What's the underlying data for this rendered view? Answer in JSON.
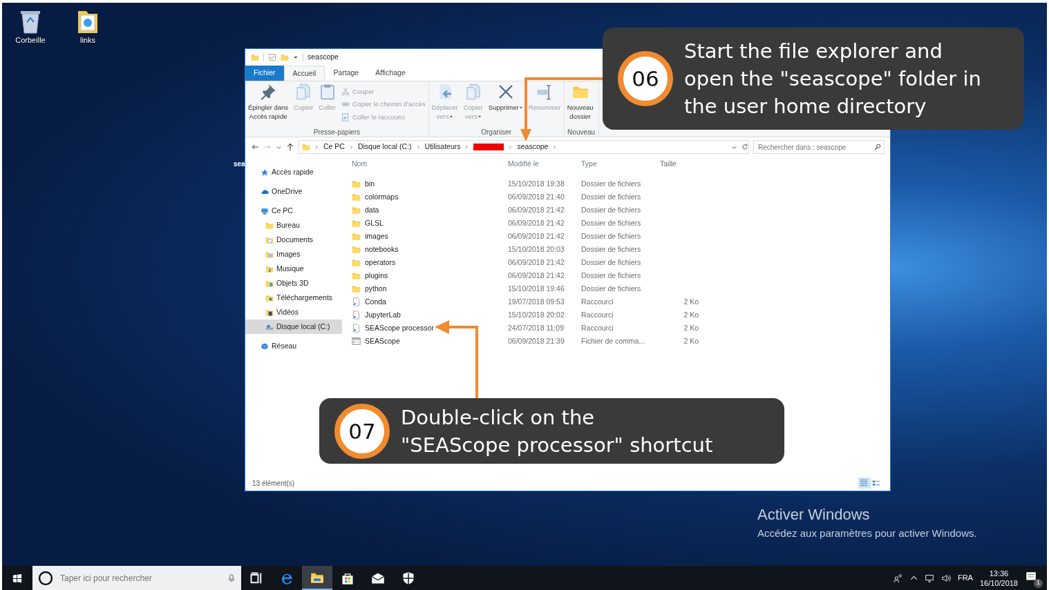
{
  "desktop_icons": [
    {
      "label": "Corbeille",
      "kind": "recycle"
    },
    {
      "label": "links",
      "kind": "folder"
    }
  ],
  "desktop_fragment": "sea",
  "window": {
    "title": "seascope",
    "ribbon_tabs": [
      {
        "label": "Fichier",
        "kind": "file",
        "selected": false
      },
      {
        "label": "Accueil",
        "kind": "tab",
        "selected": true
      },
      {
        "label": "Partage",
        "kind": "tab",
        "selected": false
      },
      {
        "label": "Affichage",
        "kind": "tab",
        "selected": false
      }
    ],
    "ribbon_groups": [
      {
        "label": "Presse-papiers",
        "large": [
          {
            "label": "Épingler dans\nAccès rapide",
            "kind": "pin",
            "disabled": false,
            "menu": false
          },
          {
            "label": "Copier",
            "kind": "copy",
            "disabled": true,
            "menu": false
          },
          {
            "label": "Coller",
            "kind": "clipboard",
            "disabled": true,
            "menu": false
          }
        ],
        "small": [
          {
            "label": "Couper",
            "kind": "scissors",
            "disabled": true
          },
          {
            "label": "Copier le chemin d'accès",
            "kind": "path",
            "disabled": true
          },
          {
            "label": "Coller le raccourci",
            "kind": "shortcut",
            "disabled": true
          }
        ]
      },
      {
        "label": "Organiser",
        "large": [
          {
            "label": "Déplacer\nvers",
            "kind": "move",
            "disabled": true,
            "menu": true
          },
          {
            "label": "Copier\nvers",
            "kind": "copy",
            "disabled": true,
            "menu": true
          },
          {
            "label": "Supprimer",
            "kind": "delete",
            "disabled": false,
            "menu": true
          },
          {
            "label": "Renommer",
            "kind": "rename",
            "disabled": true,
            "menu": false
          }
        ]
      },
      {
        "label": "Nouveau",
        "large": [
          {
            "label": "Nouveau\ndossier",
            "kind": "newfolder",
            "disabled": false,
            "menu": false
          }
        ]
      }
    ],
    "breadcrumb": [
      {
        "label": "Ce PC",
        "kind": "text"
      },
      {
        "label": "Disque local (C:)",
        "kind": "text"
      },
      {
        "label": "Utilisateurs",
        "kind": "text"
      },
      {
        "kind": "redacted"
      },
      {
        "label": "seascope",
        "kind": "text"
      }
    ],
    "search": {
      "placeholder": "Rechercher dans : seascope"
    },
    "nav": [
      {
        "label": "Accès rapide",
        "kind": "star",
        "selected": false
      },
      {
        "label": "OneDrive",
        "kind": "cloud",
        "selected": false
      },
      {
        "label": "Ce PC",
        "kind": "pc",
        "selected": false,
        "children": [
          {
            "label": "Bureau",
            "kind": "folder",
            "selected": false
          },
          {
            "label": "Documents",
            "kind": "docs",
            "selected": false
          },
          {
            "label": "Images",
            "kind": "pics",
            "selected": false
          },
          {
            "label": "Musique",
            "kind": "music",
            "selected": false
          },
          {
            "label": "Objets 3D",
            "kind": "obj3d",
            "selected": false
          },
          {
            "label": "Téléchargements",
            "kind": "download",
            "selected": false
          },
          {
            "label": "Vidéos",
            "kind": "video",
            "selected": false
          },
          {
            "label": "Disque local (C:)",
            "kind": "drive",
            "selected": true
          }
        ]
      },
      {
        "label": "Réseau",
        "kind": "network",
        "selected": false
      }
    ],
    "columns": [
      "Nom",
      "Modifié le",
      "Type",
      "Taille"
    ],
    "rows": [
      {
        "kind": "folder",
        "name": "bin",
        "modified": "15/10/2018 19:38",
        "type": "Dossier de fichiers"
      },
      {
        "kind": "folder",
        "name": "colormaps",
        "modified": "06/09/2018 21:40",
        "type": "Dossier de fichiers"
      },
      {
        "kind": "folder",
        "name": "data",
        "modified": "06/09/2018 21:42",
        "type": "Dossier de fichiers"
      },
      {
        "kind": "folder",
        "name": "GLSL",
        "modified": "06/09/2018 21:42",
        "type": "Dossier de fichiers"
      },
      {
        "kind": "folder",
        "name": "images",
        "modified": "06/09/2018 21:42",
        "type": "Dossier de fichiers"
      },
      {
        "kind": "folder",
        "name": "notebooks",
        "modified": "15/10/2018 20:03",
        "type": "Dossier de fichiers"
      },
      {
        "kind": "folder",
        "name": "operators",
        "modified": "06/09/2018 21:42",
        "type": "Dossier de fichiers"
      },
      {
        "kind": "folder",
        "name": "plugins",
        "modified": "06/09/2018 21:42",
        "type": "Dossier de fichiers"
      },
      {
        "kind": "folder",
        "name": "python",
        "modified": "15/10/2018 19:46",
        "type": "Dossier de fichiers"
      },
      {
        "kind": "shortcut",
        "name": "Conda",
        "modified": "19/07/2018 09:53",
        "type": "Raccourci",
        "size": "2 Ko"
      },
      {
        "kind": "shortcut",
        "name": "JupyterLab",
        "modified": "15/10/2018 20:02",
        "type": "Raccourci",
        "size": "2 Ko"
      },
      {
        "kind": "shortcut",
        "name": "SEAScope processor",
        "modified": "24/07/2018 11:09",
        "type": "Raccourci",
        "size": "2 Ko"
      },
      {
        "kind": "script",
        "name": "SEAScope",
        "modified": "06/09/2018 21:39",
        "type": "Fichier de comma...",
        "size": "2 Ko"
      }
    ],
    "status": "13 élément(s)",
    "views": [
      {
        "kind": "details",
        "selected": true
      },
      {
        "kind": "tiles",
        "selected": false
      }
    ]
  },
  "callouts": [
    {
      "number": "06",
      "text": "Start the file explorer and\nopen the \"seascope\" folder in\nthe user home directory"
    },
    {
      "number": "07",
      "text": "Double-click on the\n\"SEAScope processor\" shortcut"
    }
  ],
  "activation": {
    "title": "Activer Windows",
    "text": "Accédez aux paramètres pour activer Windows."
  },
  "taskbar": {
    "search_placeholder": "Taper ici pour rechercher",
    "apps": [
      {
        "kind": "taskview",
        "active": false
      },
      {
        "kind": "browser",
        "active": false
      },
      {
        "kind": "explorer",
        "active": true
      },
      {
        "kind": "store",
        "active": false
      },
      {
        "kind": "mail",
        "active": false
      },
      {
        "kind": "shield",
        "active": false
      }
    ],
    "language": "FRA",
    "time": "13:36",
    "date": "16/10/2018",
    "notification_count": "1"
  }
}
